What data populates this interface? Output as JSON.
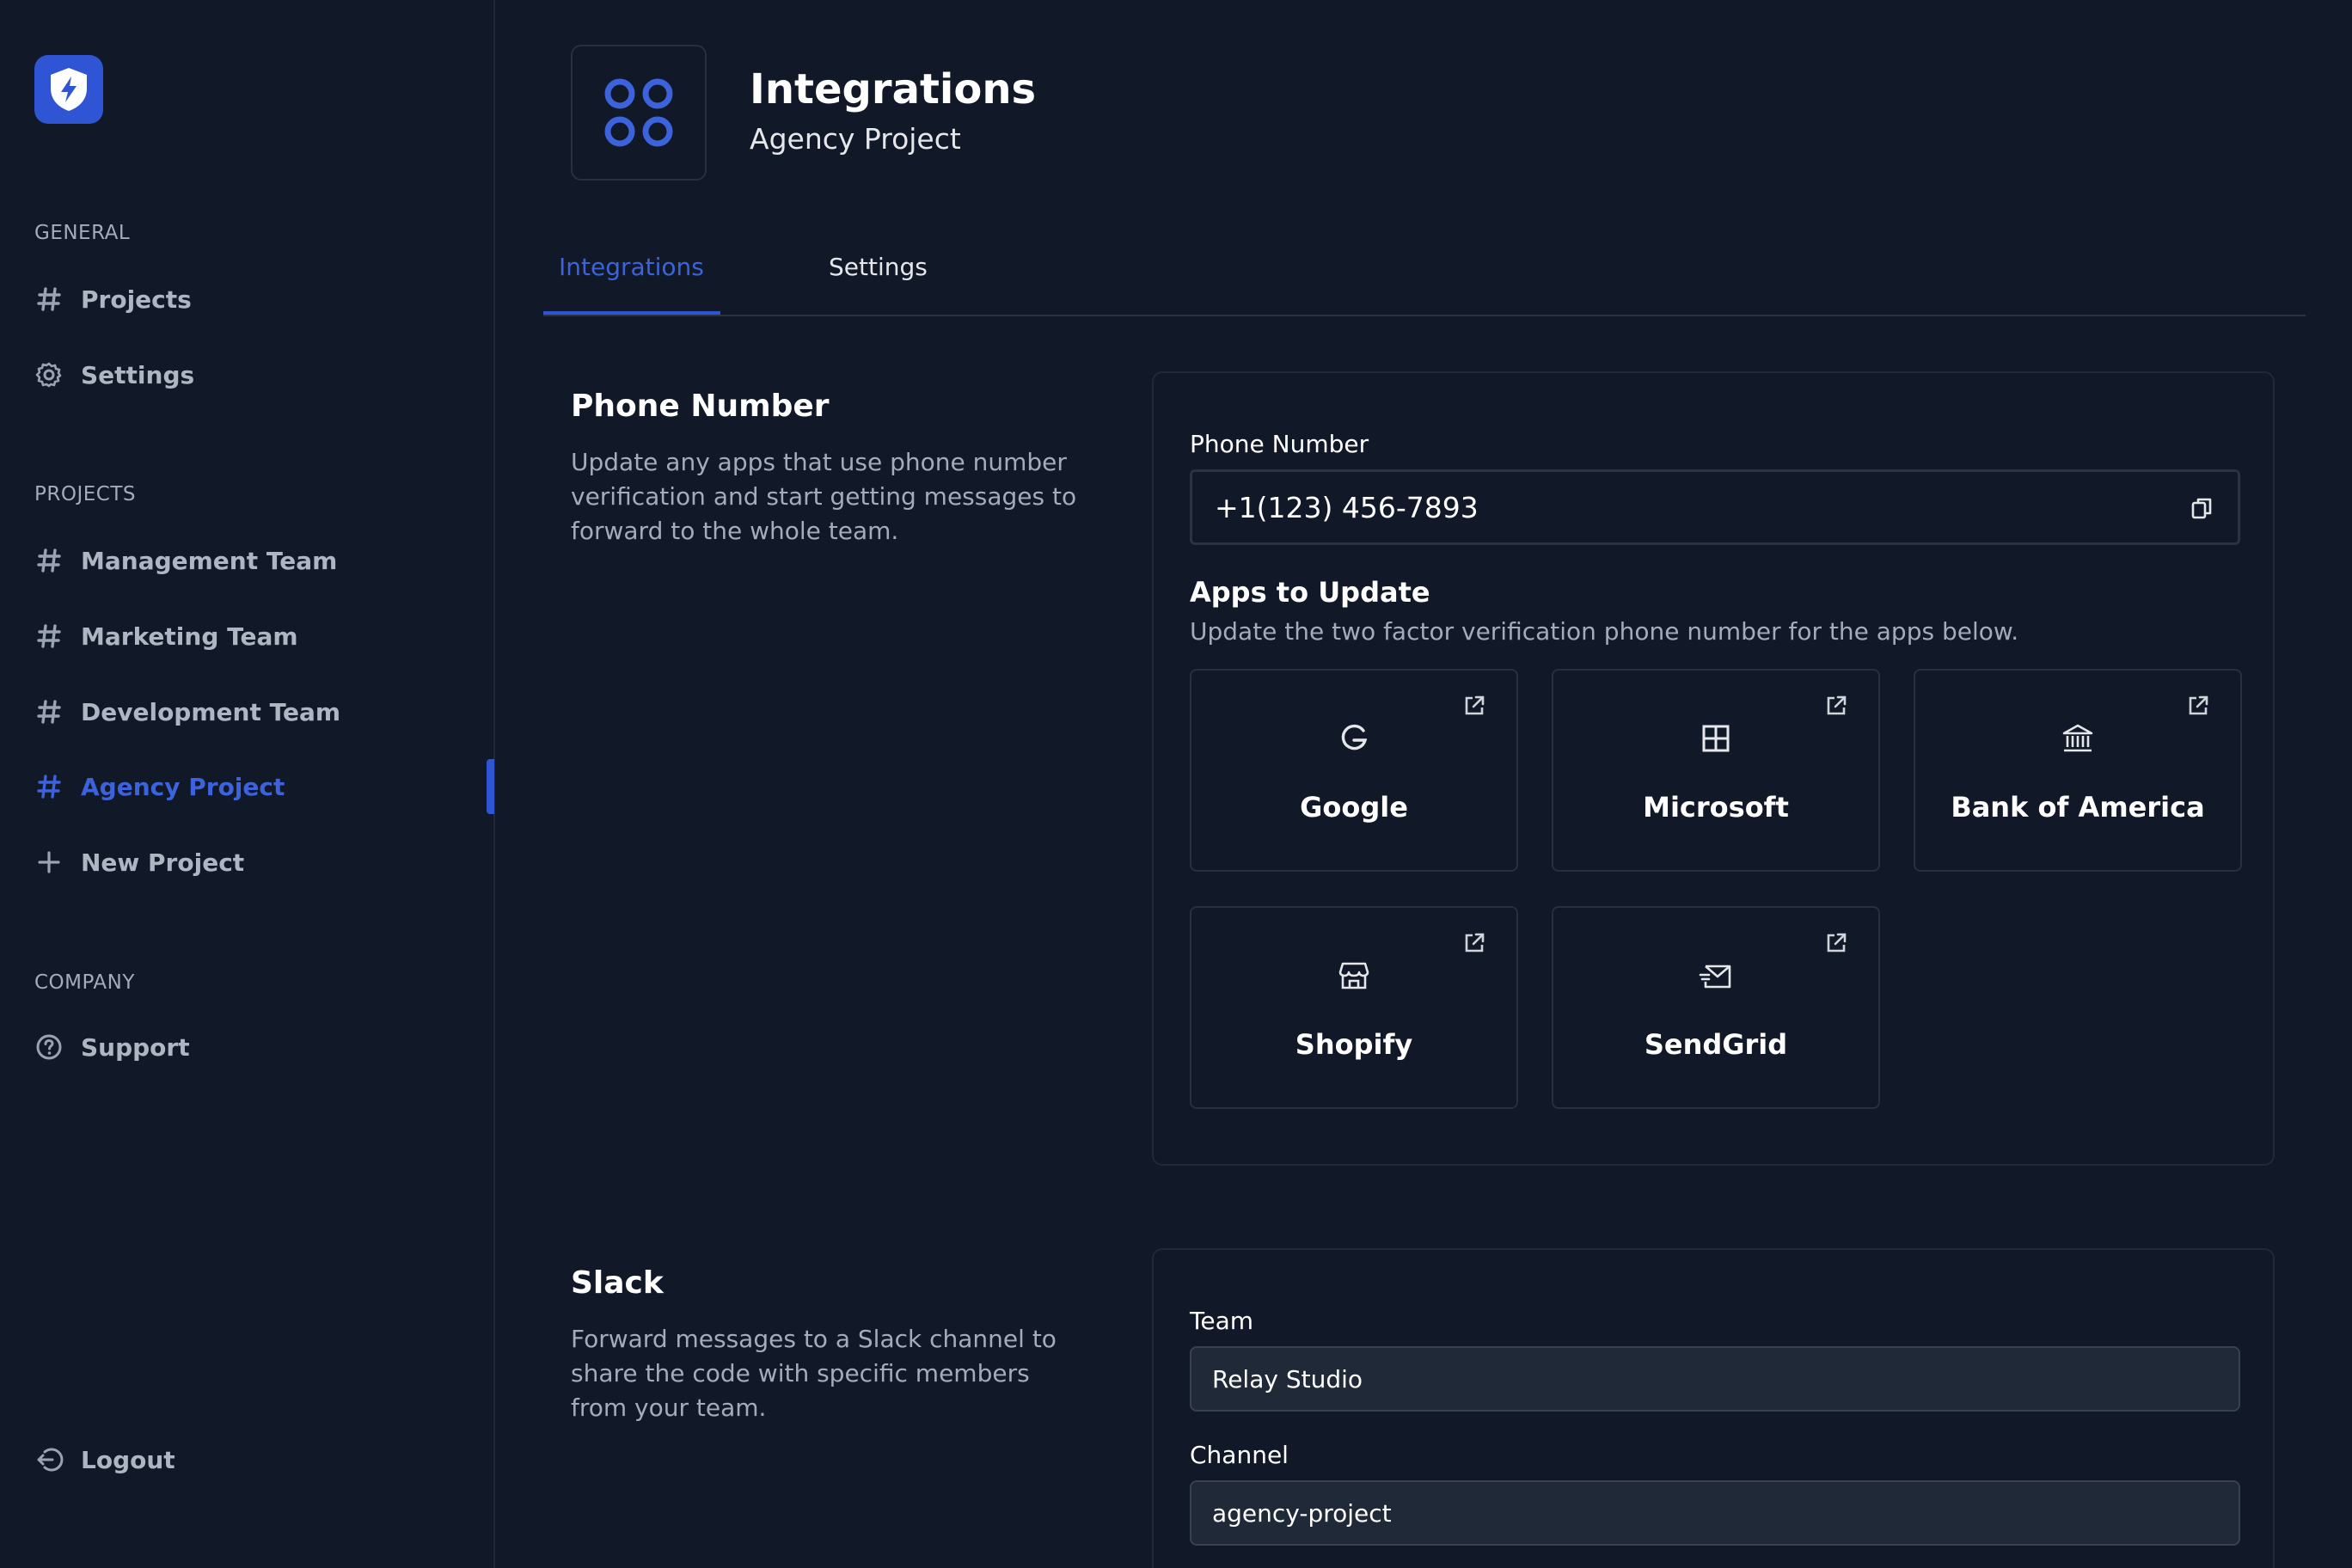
{
  "sidebar": {
    "logo_icon": "shield-bolt-icon",
    "general_label": "GENERAL",
    "general_items": [
      {
        "label": "Projects",
        "icon": "hash-icon"
      },
      {
        "label": "Settings",
        "icon": "gear-icon"
      }
    ],
    "projects_label": "PROJECTS",
    "project_items": [
      {
        "label": "Management Team",
        "icon": "hash-icon"
      },
      {
        "label": "Marketing Team",
        "icon": "hash-icon"
      },
      {
        "label": "Development Team",
        "icon": "hash-icon"
      },
      {
        "label": "Agency Project",
        "icon": "hash-icon",
        "active": true
      },
      {
        "label": "New Project",
        "icon": "plus-icon"
      }
    ],
    "company_label": "COMPANY",
    "company_items": [
      {
        "label": "Support",
        "icon": "help-circle-icon"
      }
    ],
    "logout_label": "Logout"
  },
  "header": {
    "icon": "integrations-icon",
    "title": "Integrations",
    "subtitle": "Agency Project"
  },
  "tabs": [
    {
      "label": "Integrations",
      "active": true
    },
    {
      "label": "Settings",
      "active": false
    }
  ],
  "phone_section": {
    "title": "Phone Number",
    "description": "Update any apps that use phone number verification and start getting messages to forward to the whole team.",
    "field_label": "Phone Number",
    "phone_value": "+1(123) 456-7893",
    "apps_title": "Apps to Update",
    "apps_description": "Update the two factor verification phone number for the apps below.",
    "apps": [
      {
        "name": "Google",
        "icon": "google-icon"
      },
      {
        "name": "Microsoft",
        "icon": "microsoft-icon"
      },
      {
        "name": "Bank of America",
        "icon": "bank-icon"
      },
      {
        "name": "Shopify",
        "icon": "store-icon"
      },
      {
        "name": "SendGrid",
        "icon": "mail-send-icon"
      }
    ]
  },
  "slack_section": {
    "title": "Slack",
    "description": "Forward messages to a Slack channel to share the code with specific members from your team.",
    "team_label": "Team",
    "team_value": "Relay Studio",
    "channel_label": "Channel",
    "channel_value": "agency-project"
  },
  "colors": {
    "background": "#111827",
    "accent": "#2f55d4",
    "accent_text": "#3c63dc",
    "muted_text": "#a3acbb",
    "border": "#1f2937"
  }
}
